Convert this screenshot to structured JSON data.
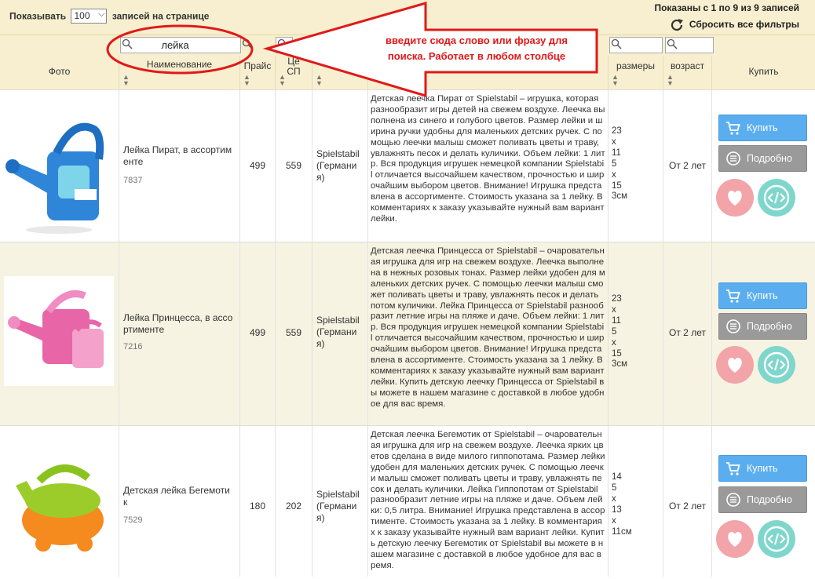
{
  "topbar": {
    "show_prefix": "Показывать",
    "show_value": "100",
    "show_suffix": "записей на странице",
    "shown_info": "Показаны с 1 по 9 из 9 записей",
    "reset_label": "Сбросить все фильтры"
  },
  "filter": {
    "value": "лейка"
  },
  "annotation": {
    "line1": "введите сюда слово или фразу для",
    "line2": "поиска. Работает в любом столбце"
  },
  "columns": {
    "photo": "Фото",
    "name": "Наименование",
    "price": "Прайс",
    "sp_price_1": "Це",
    "sp_price_2": "СП",
    "sizes": "размеры",
    "age": "возраст",
    "buy": "Купить"
  },
  "buttons": {
    "buy": "Купить",
    "more": "Подробно"
  },
  "colors": {
    "buy": "#5aaef0",
    "more": "#9a9a9a",
    "heart": "#f2a4a8",
    "code": "#7fd6cc",
    "annotation": "#e01919"
  },
  "rows": [
    {
      "name": "Лейка Пират, в ассортим енте",
      "code": "7837",
      "price": "499",
      "sp_price": "559",
      "brand": "Spielstabil (Германи я)",
      "description": "Детская леечка Пират от Spielstabil – игрушка, которая разнообразит игры детей на свежем воздухе. Леечка выполнена из синего и голубого цветов. Размер лейки и ширина ручки удобны для маленьких детских ручек. С помощью леечки малыш сможет поливать цветы и траву, увлажнять песок и делать куличики. Объем лейки: 1 литр. Вся продукция игрушек немецкой компании Spielstabil отличается высочайшем качеством, прочностью и широчайшим выбором цветов. Внимание! Игрушка представлена в ассортименте. Стоимость указана за 1 лейку. В комментариях к заказу указывайте нужный вам вариант лейки.",
      "sizes": [
        "23",
        "x",
        "11",
        "5",
        "x",
        "15",
        "3см"
      ],
      "age": "От 2 лет"
    },
    {
      "name": "Лейка Принцесса, в ассо ртименте",
      "code": "7216",
      "price": "499",
      "sp_price": "559",
      "brand": "Spielstabil (Германи я)",
      "description": "Детская леечка Принцесса от Spielstabil – очаровательная игрушка для игр на свежем воздухе. Леечка выполнена в нежных розовых тонах. Размер лейки удобен для маленьких детских ручек. С помощью леечки малыш сможет поливать цветы и траву, увлажнять песок и делать потом куличики. Лейка Принцесса от Spielstabil разнообразит летние игры на пляже и даче. Объем лейки: 1 литр. Вся продукция игрушек немецкой компании Spielstabil отличается высочайшим качеством, прочностью и широчайшим выбором цветов. Внимание! Игрушка представлена в ассортименте. Стоимость указана за 1 лейку. В комментариях к заказу указывайте нужный вам вариант лейки. Купить детскую леечку Принцесса от Spielstabil вы можете в нашем магазине с доставкой в любое удобное для вас время.",
      "sizes": [
        "23",
        "x",
        "11",
        "5",
        "x",
        "15",
        "3см"
      ],
      "age": "От 2 лет"
    },
    {
      "name": "Детская лейка Бегемоти к",
      "code": "7529",
      "price": "180",
      "sp_price": "202",
      "brand": "Spielstabil (Германи я)",
      "description": "Детская леечка Бегемотик от Spielstabil – очаровательная игрушка для игр на свежем воздухе. Леечка ярких цветов сделана в виде милого гиппопотама. Размер лейки удобен для маленьких детских ручек. С помощью леечки малыш сможет поливать цветы и траву, увлажнять песок и делать куличики. Лейка Гиппопотам от Spielstabil разнообразит летние игры на пляже и даче. Объем лейки: 0,5 литра. Внимание! Игрушка представлена в ассортименте. Стоимость указана за 1 лейку. В комментариях к заказу указывайте нужный вам вариант лейки. Купить детскую леечку Бегемотик от Spielstabil вы можете в нашем магазине с доставкой в любое удобное для вас время.",
      "sizes": [
        "14",
        "5",
        "x",
        "13",
        "x",
        "11см"
      ],
      "age": "От 2 лет"
    }
  ]
}
